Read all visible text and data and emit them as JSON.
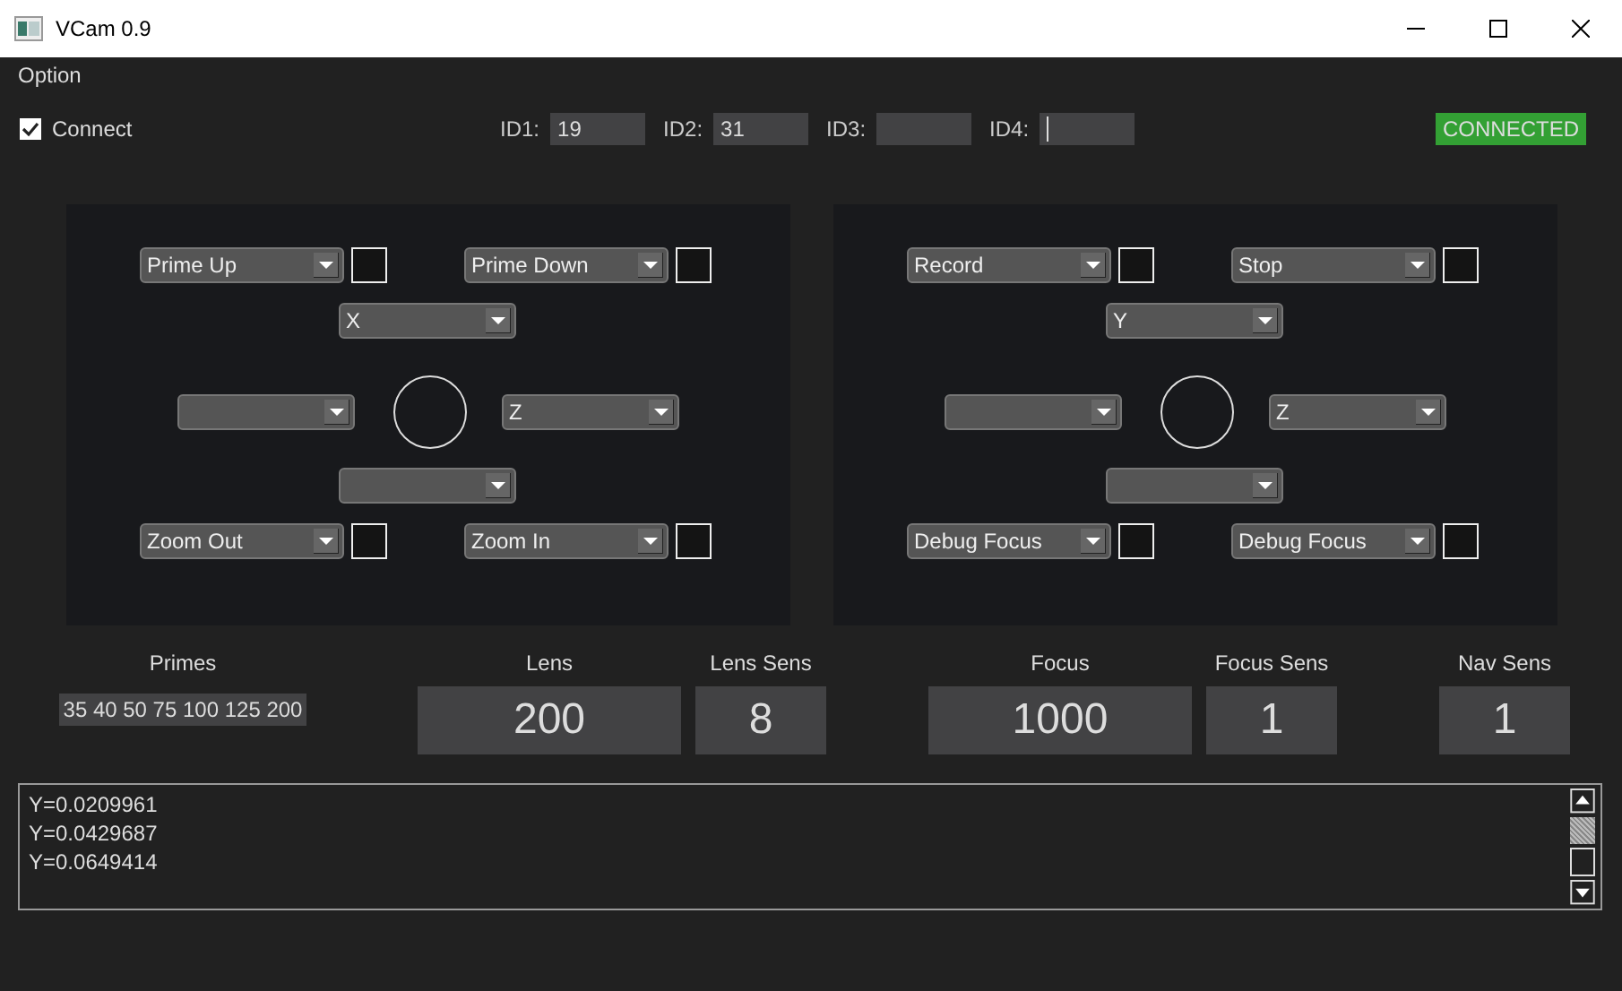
{
  "window": {
    "title": "VCam 0.9"
  },
  "menu": [
    {
      "label": "Option"
    }
  ],
  "connect": {
    "label": "Connect",
    "checked": true
  },
  "ids": [
    {
      "label": "ID1:",
      "value": "19",
      "focused": false
    },
    {
      "label": "ID2:",
      "value": "31",
      "focused": false
    },
    {
      "label": "ID3:",
      "focused": false
    },
    {
      "label": "ID4:",
      "focused": true
    }
  ],
  "status": {
    "text": "CONNECTED",
    "connected": true
  },
  "panels": [
    {
      "top_left": {
        "value": "Prime Up",
        "checked": false
      },
      "top_right": {
        "value": "Prime Down",
        "checked": false
      },
      "top": {
        "value": "X"
      },
      "left": {
        "kind": "dropdown"
      },
      "right": {
        "value": "Z"
      },
      "bottom": {
        "kind": "dropdown"
      },
      "bottom_left": {
        "value": "Zoom Out",
        "checked": false
      },
      "bottom_right": {
        "value": "Zoom In",
        "checked": false
      }
    },
    {
      "top_left": {
        "value": "Record",
        "checked": false
      },
      "top_right": {
        "value": "Stop",
        "checked": false
      },
      "top": {
        "value": "Y"
      },
      "left": {
        "kind": "dropdown"
      },
      "right": {
        "value": "Z"
      },
      "bottom": {
        "kind": "dropdown"
      },
      "bottom_left": {
        "value": "Debug Focus",
        "checked": false
      },
      "bottom_right": {
        "value": "Debug Focus",
        "checked": false
      }
    }
  ],
  "primes": {
    "label": "Primes",
    "value": "35 40 50 75 100 125 200"
  },
  "readouts": [
    {
      "label": "Lens",
      "value": "200",
      "kind": "wide"
    },
    {
      "label": "Lens Sens",
      "value": "8",
      "kind": "narrow"
    },
    {
      "label": "Focus",
      "value": "1000",
      "kind": "wide"
    },
    {
      "label": "Focus Sens",
      "value": "1",
      "kind": "narrow"
    },
    {
      "label": "Nav Sens",
      "value": "1",
      "kind": "narrow"
    }
  ],
  "log": [
    "Y=0.0209961",
    "Y=0.0429687",
    "Y=0.0649414"
  ]
}
